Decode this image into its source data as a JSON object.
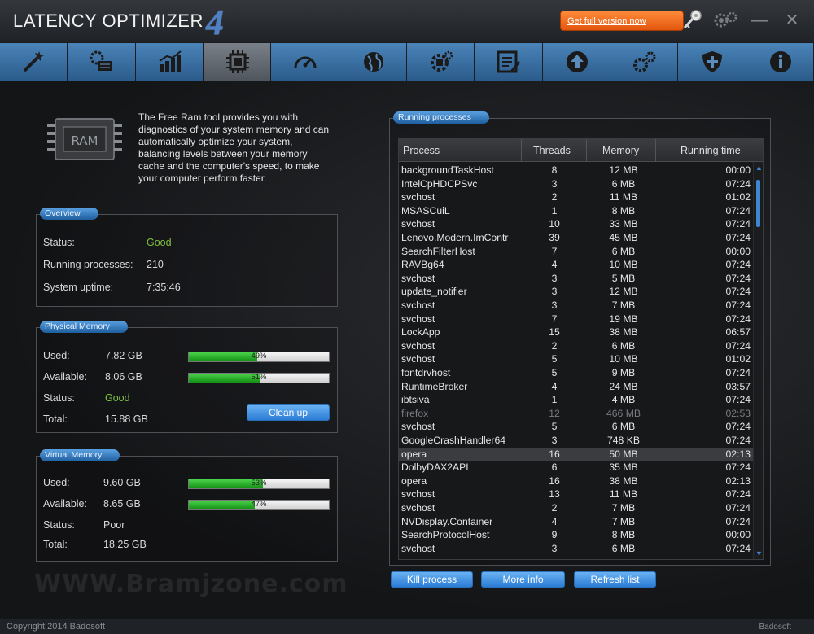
{
  "app": {
    "title": "LATENCY OPTIMIZER",
    "version": "4",
    "get_full_version": "Get full version now"
  },
  "window_buttons": {
    "minimize": "—",
    "close": "✕"
  },
  "toolbar": {
    "items": [
      {
        "icon": "wand-icon"
      },
      {
        "icon": "settings-list-icon"
      },
      {
        "icon": "bar-chart-icon"
      },
      {
        "icon": "memory-chip-icon",
        "active": true
      },
      {
        "icon": "speedometer-icon"
      },
      {
        "icon": "globe-icon"
      },
      {
        "icon": "cpu-gear-icon"
      },
      {
        "icon": "edit-list-icon"
      },
      {
        "icon": "upload-icon"
      },
      {
        "icon": "gears-icon"
      },
      {
        "icon": "shield-icon"
      },
      {
        "icon": "info-icon"
      }
    ]
  },
  "intro": "The Free Ram tool provides you with diagnostics of your system memory and can automatically optimize your system, balancing levels between your memory cache and the computer's speed, to make your computer perform faster.",
  "overview": {
    "title": "Overview",
    "status_label": "Status:",
    "status_value": "Good",
    "processes_label": "Running processes:",
    "processes_value": "210",
    "uptime_label": "System uptime:",
    "uptime_value": "7:35:46"
  },
  "physical": {
    "title": "Physical Memory",
    "used_label": "Used:",
    "used_value": "7.82 GB",
    "used_pct": "49%",
    "avail_label": "Available:",
    "avail_value": "8.06 GB",
    "avail_pct": "51%",
    "status_label": "Status:",
    "status_value": "Good",
    "total_label": "Total:",
    "total_value": "15.88 GB",
    "cleanup": "Clean up"
  },
  "virtual": {
    "title": "Virtual Memory",
    "used_label": "Used:",
    "used_value": "9.60 GB",
    "used_pct": "53%",
    "avail_label": "Available:",
    "avail_value": "8.65 GB",
    "avail_pct": "47%",
    "status_label": "Status:",
    "status_value": "Poor",
    "total_label": "Total:",
    "total_value": "18.25 GB"
  },
  "processes": {
    "title": "Running processes",
    "headers": {
      "process": "Process",
      "threads": "Threads",
      "memory": "Memory",
      "time": "Running time"
    },
    "rows": [
      [
        "backgroundTaskHost",
        "8",
        "12 MB",
        "00:00"
      ],
      [
        "IntelCpHDCPSvc",
        "3",
        "6 MB",
        "07:24"
      ],
      [
        "svchost",
        "2",
        "11 MB",
        "01:02"
      ],
      [
        "MSASCuiL",
        "1",
        "8 MB",
        "07:24"
      ],
      [
        "svchost",
        "10",
        "33 MB",
        "07:24"
      ],
      [
        "Lenovo.Modern.ImContr",
        "39",
        "45 MB",
        "07:24"
      ],
      [
        "SearchFilterHost",
        "7",
        "6 MB",
        "00:00"
      ],
      [
        "RAVBg64",
        "4",
        "10 MB",
        "07:24"
      ],
      [
        "svchost",
        "3",
        "5 MB",
        "07:24"
      ],
      [
        "update_notifier",
        "3",
        "12 MB",
        "07:24"
      ],
      [
        "svchost",
        "3",
        "7 MB",
        "07:24"
      ],
      [
        "svchost",
        "7",
        "19 MB",
        "07:24"
      ],
      [
        "LockApp",
        "15",
        "38 MB",
        "06:57"
      ],
      [
        "svchost",
        "2",
        "6 MB",
        "07:24"
      ],
      [
        "svchost",
        "5",
        "10 MB",
        "01:02"
      ],
      [
        "fontdrvhost",
        "5",
        "9 MB",
        "07:24"
      ],
      [
        "RuntimeBroker",
        "4",
        "24 MB",
        "03:57"
      ],
      [
        "ibtsiva",
        "1",
        "4 MB",
        "07:24"
      ],
      [
        "firefox",
        "12",
        "466 MB",
        "02:53"
      ],
      [
        "svchost",
        "5",
        "6 MB",
        "07:24"
      ],
      [
        "GoogleCrashHandler64",
        "3",
        "748 KB",
        "07:24"
      ],
      [
        "opera",
        "16",
        "50 MB",
        "02:13"
      ],
      [
        "DolbyDAX2API",
        "6",
        "35 MB",
        "07:24"
      ],
      [
        "opera",
        "16",
        "38 MB",
        "02:13"
      ],
      [
        "svchost",
        "13",
        "11 MB",
        "07:24"
      ],
      [
        "svchost",
        "2",
        "7 MB",
        "07:24"
      ],
      [
        "NVDisplay.Container",
        "4",
        "7 MB",
        "07:24"
      ],
      [
        "SearchProtocolHost",
        "9",
        "8 MB",
        "00:00"
      ],
      [
        "svchost",
        "3",
        "6 MB",
        "07:24"
      ]
    ],
    "selected_row": 21,
    "dim_row": 18
  },
  "buttons": {
    "kill": "Kill process",
    "more": "More info",
    "refresh": "Refresh list"
  },
  "footer": {
    "copyright": "Copyright 2014 Badosoft",
    "brand": "Badosoft"
  },
  "watermark": "WWW.Bramjzone.com",
  "colors": {
    "accent": "#2b7cd6",
    "good": "#7ec040",
    "orange": "#e2560c"
  }
}
